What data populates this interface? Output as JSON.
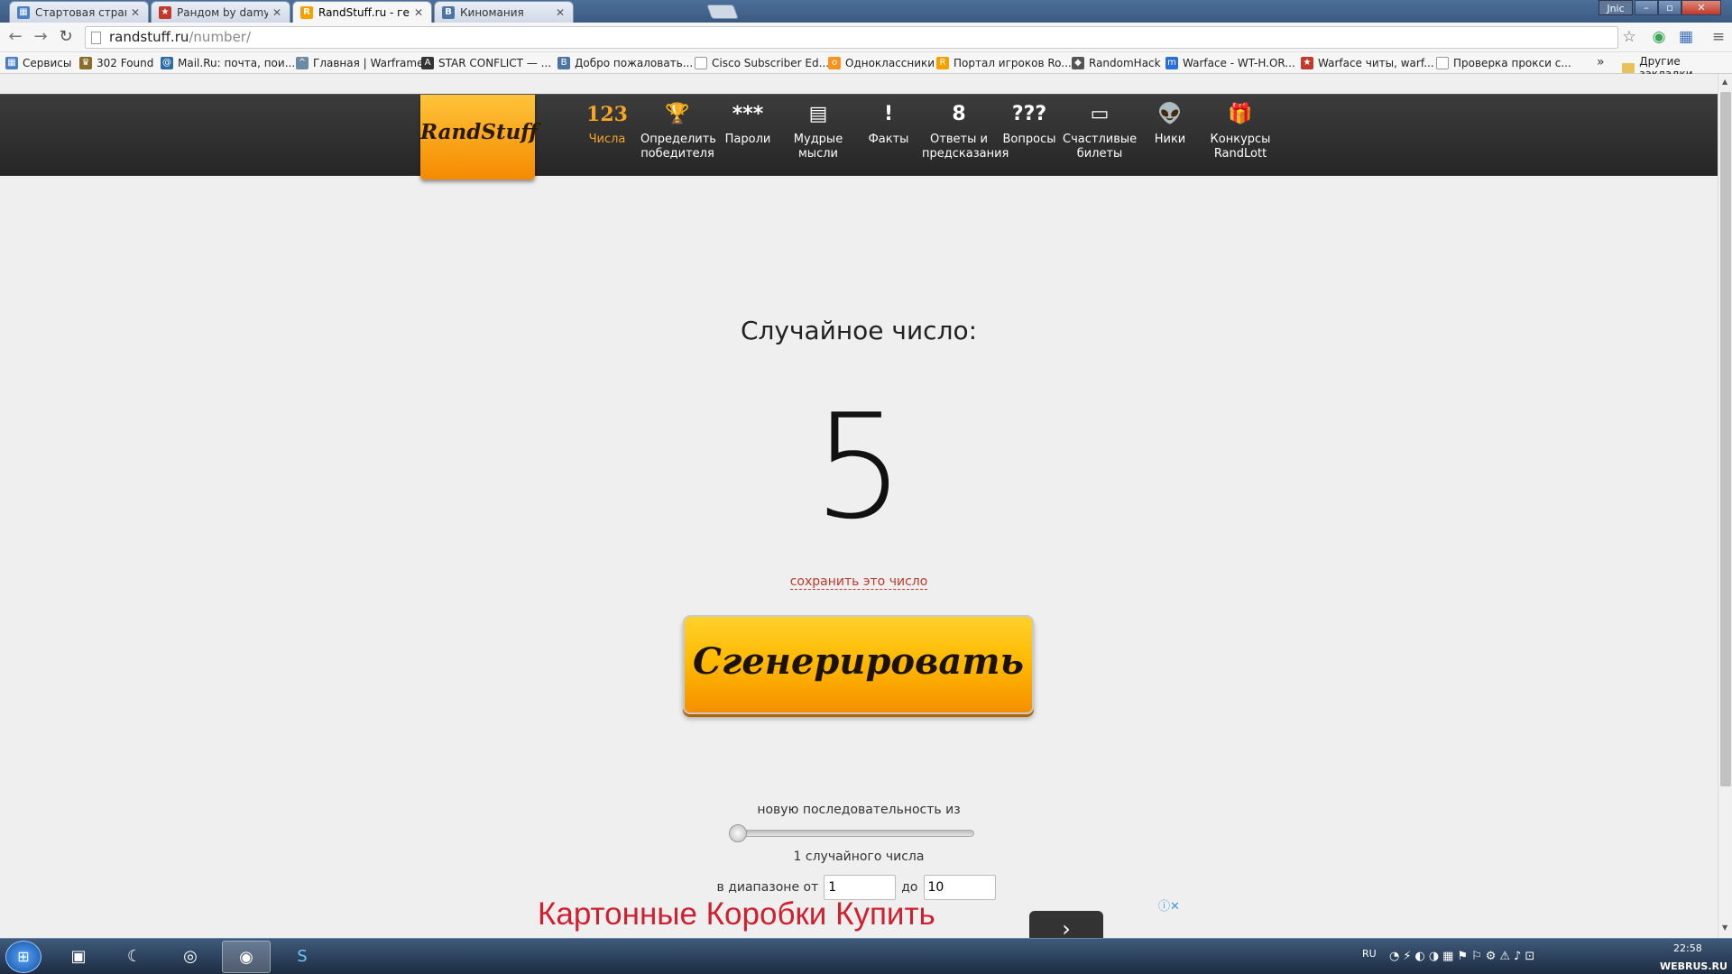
{
  "browser": {
    "tabs": [
      {
        "title": "Стартовая страница - ви",
        "icon_color": "#4a7fc1",
        "icon": "grid-icon"
      },
      {
        "title": "Рандом by damy - Стран",
        "icon_color": "#c0392b",
        "icon": "star-icon"
      },
      {
        "title": "RandStuff.ru - генератор",
        "icon_color": "#f5a000",
        "icon": "randstuff-icon"
      },
      {
        "title": "Киномания",
        "icon_color": "#4c75a3",
        "icon": "vk-icon"
      }
    ],
    "user_badge": "Jnic",
    "url_host": "randstuff.ru",
    "url_path": "/number/",
    "bookmarks": [
      {
        "label": "Сервисы",
        "icon": "apps-icon",
        "color": "#4a7fc1"
      },
      {
        "label": "302 Found",
        "icon": "crown-icon",
        "color": "#8a6d2a"
      },
      {
        "label": "Mail.Ru: почта, пои...",
        "icon": "mailru-icon",
        "color": "#2d6ca2"
      },
      {
        "label": "Главная | Warframe",
        "icon": "warframe-icon",
        "color": "#6c8aa3"
      },
      {
        "label": "STAR CONFLICT — ...",
        "icon": "starconflict-icon",
        "color": "#333333"
      },
      {
        "label": "Добро пожаловать...",
        "icon": "vk-icon",
        "color": "#4c75a3"
      },
      {
        "label": "Cisco Subscriber Ed...",
        "icon": "page-icon",
        "color": "#999999"
      },
      {
        "label": "Одноклассники",
        "icon": "ok-icon",
        "color": "#f7931e"
      },
      {
        "label": "Портал игроков Ro...",
        "icon": "r-icon",
        "color": "#f5a000"
      },
      {
        "label": "RandomHack",
        "icon": "shield-icon",
        "color": "#555555"
      },
      {
        "label": "Warface - WT-H.OR...",
        "icon": "m-icon",
        "color": "#2a6fd6"
      },
      {
        "label": "Warface читы, warf...",
        "icon": "star-icon",
        "color": "#c0392b"
      },
      {
        "label": "Проверка прокси с...",
        "icon": "page-icon",
        "color": "#999999"
      }
    ],
    "bookmarks_more": "»",
    "other_bookmarks": "Другие закладки"
  },
  "site": {
    "logo": "RandStuff",
    "nav": [
      {
        "icon": "123",
        "label": "Числа",
        "name": "numbers"
      },
      {
        "icon": "🏆",
        "label": "Определить победителя",
        "name": "winner"
      },
      {
        "icon": "***",
        "label": "Пароли",
        "name": "passwords"
      },
      {
        "icon": "▤",
        "label": "Мудрые мысли",
        "name": "wise-thoughts"
      },
      {
        "icon": "!",
        "label": "Факты",
        "name": "facts"
      },
      {
        "icon": "8",
        "label": "Ответы и предсказания",
        "name": "answers"
      },
      {
        "icon": "???",
        "label": "Вопросы",
        "name": "questions"
      },
      {
        "icon": "▭",
        "label": "Счастливые билеты",
        "name": "lucky-tickets"
      },
      {
        "icon": "👽",
        "label": "Ники",
        "name": "nicknames"
      },
      {
        "icon": "🎁",
        "label": "Конкурсы RandLott",
        "name": "randlott"
      }
    ],
    "title": "Случайное число:",
    "result": "5",
    "save_link": "сохранить это число",
    "generate_button": "Сгенерировать",
    "sequence_label": "новую последовательность из",
    "count_level": 1,
    "count_label": "1 случайного числа",
    "range_from_label": "в диапазоне от",
    "range_to_label": "до",
    "range_from": "1",
    "range_to": "10",
    "ad_text": "Картонные Коробки Купить",
    "ad_icons": "ⓘ✕"
  },
  "taskbar": {
    "lang": "RU",
    "time": "22:58",
    "watermark": "WEBRUS.RU"
  },
  "colors": {
    "accent": "#f6a623",
    "link": "#c0392b",
    "ad": "#d0202f"
  }
}
